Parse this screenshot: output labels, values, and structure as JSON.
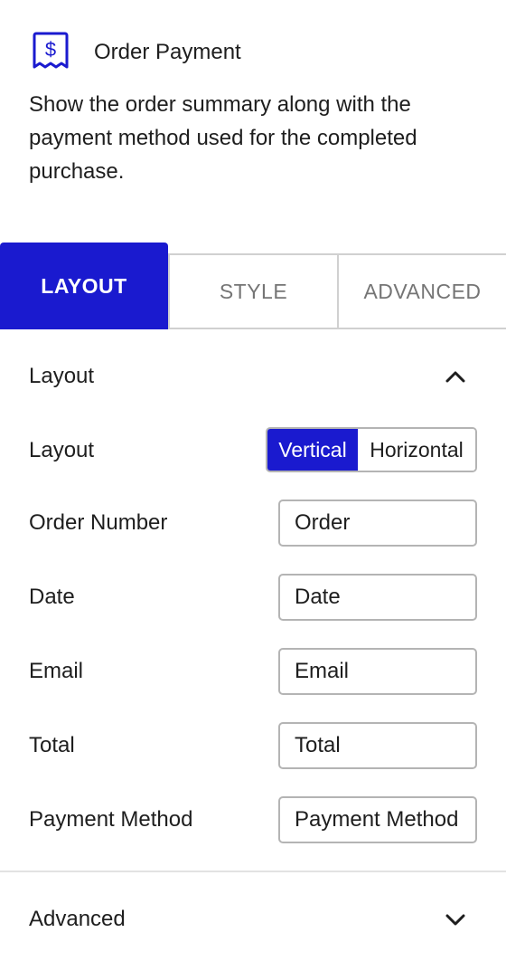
{
  "block": {
    "icon": "receipt-dollar-icon",
    "title": "Order Payment",
    "description": "Show the order summary along with the payment method used for the completed purchase."
  },
  "tabs": [
    {
      "label": "LAYOUT",
      "active": true
    },
    {
      "label": "STYLE",
      "active": false
    },
    {
      "label": "ADVANCED",
      "active": false
    }
  ],
  "layout_panel": {
    "title": "Layout",
    "expanded": true,
    "layout_row": {
      "label": "Layout",
      "options": [
        "Vertical",
        "Horizontal"
      ],
      "selected": "Vertical"
    },
    "fields": [
      {
        "label": "Order Number",
        "value": "Order"
      },
      {
        "label": "Date",
        "value": "Date"
      },
      {
        "label": "Email",
        "value": "Email"
      },
      {
        "label": "Total",
        "value": "Total"
      },
      {
        "label": "Payment Method",
        "value": "Payment Method"
      }
    ]
  },
  "advanced_panel": {
    "title": "Advanced",
    "expanded": false
  },
  "colors": {
    "accent": "#1a1acf",
    "border": "#b4b4b4",
    "text": "#1e1e1e",
    "muted": "#757575"
  }
}
